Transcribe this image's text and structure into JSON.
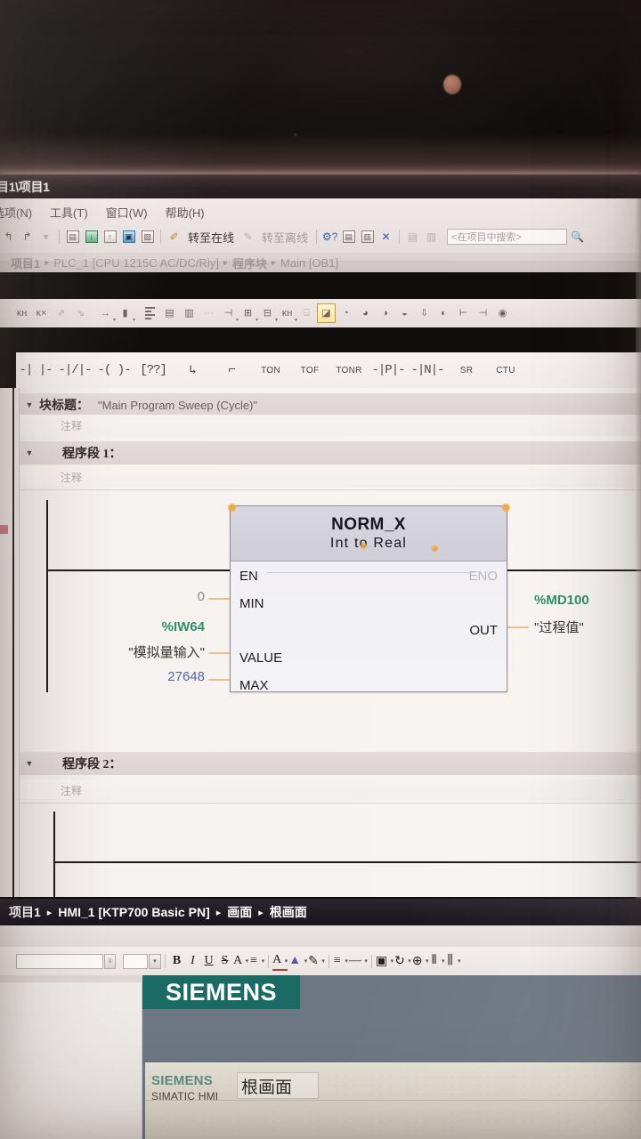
{
  "window": {
    "title": "目1\\项目1"
  },
  "menu": {
    "items": [
      {
        "label": "选项(N)"
      },
      {
        "label": "工具(T)"
      },
      {
        "label": "窗口(W)"
      },
      {
        "label": "帮助(H)"
      }
    ]
  },
  "toolbar": {
    "icons": [
      {
        "name": "undo-icon",
        "glyph": "↰"
      },
      {
        "name": "redo-icon",
        "glyph": "↱"
      },
      {
        "name": "compile-icon",
        "glyph": "▤"
      },
      {
        "name": "download-to-device-icon",
        "glyph": "↓"
      },
      {
        "name": "upload-from-device-icon",
        "glyph": "↑"
      },
      {
        "name": "start-simulation-icon",
        "glyph": "▣"
      },
      {
        "name": "start-runtime-icon",
        "glyph": "▧"
      },
      {
        "name": "online-diagnostics-icon",
        "glyph": "✐"
      }
    ],
    "go_online_label": "转至在线",
    "go_offline_label": "转至离线",
    "help_icon": "gear-question-icon",
    "cross_reference_icon": "cross-reference-icon",
    "call_structure_icon": "call-structure-icon",
    "close_label": "✕",
    "split_horizontal_icon": "split-horizontal-icon",
    "split_vertical_icon": "split-vertical-icon",
    "search_placeholder": "<在项目中搜索>"
  },
  "breadcrumb_plc": {
    "items": [
      "项目1",
      "PLC_1 [CPU 1215C AC/DC/Rly]",
      "程序块",
      "Main [OB1]"
    ],
    "separator": "▸"
  },
  "editor_toolbar": {
    "icons": [
      {
        "name": "insert-network-icon",
        "glyph": "KH"
      },
      {
        "name": "delete-network-icon",
        "glyph": "KX"
      },
      {
        "name": "upload-block-icon",
        "glyph": "⇗"
      },
      {
        "name": "download-block-icon",
        "glyph": "⇘"
      },
      {
        "name": "goto-next-icon",
        "glyph": "→"
      },
      {
        "name": "absolute-symbolic-icon",
        "glyph": "▮"
      },
      {
        "name": "show-hide-interface-icon",
        "glyph": "≡"
      },
      {
        "name": "show-favorites-icon",
        "glyph": "▤"
      },
      {
        "name": "show-symbols-icon",
        "glyph": "▥"
      },
      {
        "name": "comment-toggle-icon",
        "glyph": "···"
      },
      {
        "name": "insert-branch-icon",
        "glyph": "⊣"
      },
      {
        "name": "insert-rung-icon",
        "glyph": "⊞"
      },
      {
        "name": "insert-box-icon",
        "glyph": "⊟"
      },
      {
        "name": "kh-insert-icon",
        "glyph": "KH"
      },
      {
        "name": "bookmark-icon",
        "glyph": "⌸"
      },
      {
        "name": "monitor-icon",
        "glyph": "👁"
      },
      {
        "name": "monitor-on-icon",
        "glyph": "◔"
      },
      {
        "name": "monitor-off-icon",
        "glyph": "◕"
      },
      {
        "name": "modify-operand-icon",
        "glyph": "◑"
      },
      {
        "name": "modify-value-icon",
        "glyph": "◒"
      },
      {
        "name": "force-icon",
        "glyph": "⇩"
      },
      {
        "name": "breakpoint-icon",
        "glyph": "◐"
      },
      {
        "name": "indent-icon",
        "glyph": "⊢"
      },
      {
        "name": "outdent-icon",
        "glyph": "⊣"
      },
      {
        "name": "more-icon",
        "glyph": "◉"
      }
    ]
  },
  "favorites": {
    "items": [
      {
        "name": "normally-open-contact",
        "label": "-| |-"
      },
      {
        "name": "normally-closed-contact",
        "label": "-|/|-"
      },
      {
        "name": "output-coil",
        "label": "-( )-"
      },
      {
        "name": "empty-box",
        "label": "[??]"
      },
      {
        "name": "open-branch",
        "label": "↳"
      },
      {
        "name": "close-branch",
        "label": "⌐"
      },
      {
        "name": "ton-timer",
        "label": "TON"
      },
      {
        "name": "tof-timer",
        "label": "TOF"
      },
      {
        "name": "tonr-timer",
        "label": "TONR"
      },
      {
        "name": "positive-edge",
        "label": "-|P|-"
      },
      {
        "name": "negative-edge",
        "label": "-|N|-"
      },
      {
        "name": "sr-flipflop",
        "label": "SR"
      },
      {
        "name": "ctu-counter",
        "label": "CTU"
      }
    ]
  },
  "code": {
    "block_title_label": "块标题：",
    "block_title_value": "\"Main Program Sweep (Cycle)\"",
    "comment_placeholder": "注释",
    "networks": [
      {
        "title": "程序段 1：",
        "comment": "注释"
      },
      {
        "title": "程序段 2：",
        "comment": "注释"
      }
    ]
  },
  "norm_x": {
    "title": "NORM_X",
    "subtitle": "Int to Real",
    "pins": {
      "en": "EN",
      "eno": "ENO",
      "min": "MIN",
      "value": "VALUE",
      "max": "MAX",
      "out": "OUT"
    },
    "operands": {
      "min_value": "0",
      "value_address": "%IW64",
      "value_name": "\"模拟量输入\"",
      "max_value": "27648",
      "out_address": "%MD100",
      "out_name": "\"过程值\""
    }
  },
  "breadcrumb_hmi": {
    "items": [
      "项目1",
      "HMI_1 [KTP700 Basic PN]",
      "画面",
      "根画面"
    ],
    "separator": "▸"
  },
  "format_bar": {
    "font_size_value": "",
    "bold": "B",
    "italic": "I",
    "underline": "U",
    "strikethrough": "S",
    "font_scale": "A",
    "align": "≡",
    "font_color_icon": "A",
    "fill-color_icon": "▲",
    "line-color_icon": "✎",
    "list_icon": "≡",
    "line_style_icon": "—",
    "order_back_icon": "▣",
    "rotate_icon": "↻",
    "align_center_icon": "⊕",
    "distribute_icon": "⦀"
  },
  "hmi_screen": {
    "logo_text": "SIEMENS",
    "card_logo": "SIEMENS",
    "card_subtitle": "SIMATIC HMI",
    "card_title": "根画面"
  },
  "colors": {
    "accent_green": "#2c8e6f",
    "siemens_teal": "#1a6b63",
    "constant_blue": "#5566a8",
    "highlight_orange": "#f0a82c",
    "hmi_background": "#6c7783",
    "breadcrumb_dark": "#211d26"
  }
}
